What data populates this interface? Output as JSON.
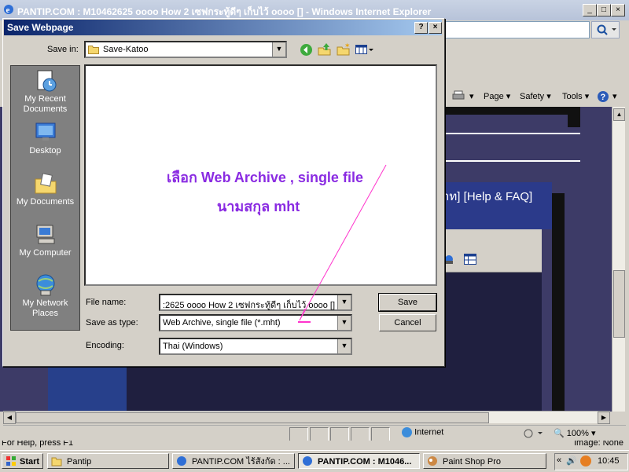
{
  "ie_window": {
    "title": "PANTIP.COM : M10462625 oooo How 2 เซฟกระทู้ดีๆ เก็บไว้ oooo [] - Windows Internet Explorer",
    "toolbar": {
      "page": "Page",
      "safety": "Safety",
      "tools": "Tools"
    },
    "page_content": {
      "help_faq": "าท] [Help & FAQ]"
    }
  },
  "status_bar": {
    "help_text": "For Help, press F1",
    "zone": "Internet",
    "zoom": "100%",
    "image": "Image: None"
  },
  "dialog": {
    "title": "Save Webpage",
    "help_btn": "?",
    "close_btn": "×",
    "save_in_label": "Save in:",
    "save_in_value": "Save-Katoo",
    "places": [
      "My Recent Documents",
      "Desktop",
      "My Documents",
      "My Computer",
      "My Network Places"
    ],
    "file_name_label": "File name:",
    "file_name_value": ":2625 oooo How 2 เซฟกระทู้ดีๆ เก็บไว้ oooo []",
    "save_type_label": "Save as type:",
    "save_type_value": "Web Archive, single file (*.mht)",
    "encoding_label": "Encoding:",
    "encoding_value": "Thai (Windows)",
    "save_button": "Save",
    "cancel_button": "Cancel",
    "annotation_line1": "เลือก Web Archive , single file",
    "annotation_line2": "นามสกุล mht",
    "annotation_color": "#8A2BE2",
    "arrow_color": "#FF33CC"
  },
  "taskbar": {
    "start": "Start",
    "tasks": [
      "Pantip",
      "PANTIP.COM ไร้สังกัด : ...",
      "PANTIP.COM : M1046...",
      "Paint Shop Pro"
    ],
    "clock": "10:45"
  }
}
